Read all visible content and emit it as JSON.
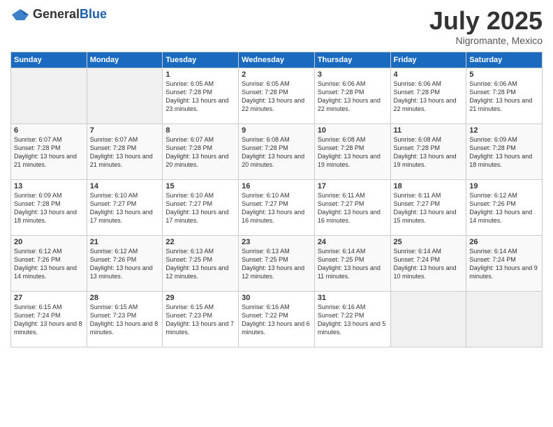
{
  "header": {
    "logo_general": "General",
    "logo_blue": "Blue",
    "month": "July 2025",
    "location": "Nigromante, Mexico"
  },
  "weekdays": [
    "Sunday",
    "Monday",
    "Tuesday",
    "Wednesday",
    "Thursday",
    "Friday",
    "Saturday"
  ],
  "weeks": [
    [
      {
        "day": "",
        "empty": true
      },
      {
        "day": "",
        "empty": true
      },
      {
        "day": "1",
        "sunrise": "Sunrise: 6:05 AM",
        "sunset": "Sunset: 7:28 PM",
        "daylight": "Daylight: 13 hours and 23 minutes."
      },
      {
        "day": "2",
        "sunrise": "Sunrise: 6:05 AM",
        "sunset": "Sunset: 7:28 PM",
        "daylight": "Daylight: 13 hours and 22 minutes."
      },
      {
        "day": "3",
        "sunrise": "Sunrise: 6:06 AM",
        "sunset": "Sunset: 7:28 PM",
        "daylight": "Daylight: 13 hours and 22 minutes."
      },
      {
        "day": "4",
        "sunrise": "Sunrise: 6:06 AM",
        "sunset": "Sunset: 7:28 PM",
        "daylight": "Daylight: 13 hours and 22 minutes."
      },
      {
        "day": "5",
        "sunrise": "Sunrise: 6:06 AM",
        "sunset": "Sunset: 7:28 PM",
        "daylight": "Daylight: 13 hours and 21 minutes."
      }
    ],
    [
      {
        "day": "6",
        "sunrise": "Sunrise: 6:07 AM",
        "sunset": "Sunset: 7:28 PM",
        "daylight": "Daylight: 13 hours and 21 minutes."
      },
      {
        "day": "7",
        "sunrise": "Sunrise: 6:07 AM",
        "sunset": "Sunset: 7:28 PM",
        "daylight": "Daylight: 13 hours and 21 minutes."
      },
      {
        "day": "8",
        "sunrise": "Sunrise: 6:07 AM",
        "sunset": "Sunset: 7:28 PM",
        "daylight": "Daylight: 13 hours and 20 minutes."
      },
      {
        "day": "9",
        "sunrise": "Sunrise: 6:08 AM",
        "sunset": "Sunset: 7:28 PM",
        "daylight": "Daylight: 13 hours and 20 minutes."
      },
      {
        "day": "10",
        "sunrise": "Sunrise: 6:08 AM",
        "sunset": "Sunset: 7:28 PM",
        "daylight": "Daylight: 13 hours and 19 minutes."
      },
      {
        "day": "11",
        "sunrise": "Sunrise: 6:08 AM",
        "sunset": "Sunset: 7:28 PM",
        "daylight": "Daylight: 13 hours and 19 minutes."
      },
      {
        "day": "12",
        "sunrise": "Sunrise: 6:09 AM",
        "sunset": "Sunset: 7:28 PM",
        "daylight": "Daylight: 13 hours and 18 minutes."
      }
    ],
    [
      {
        "day": "13",
        "sunrise": "Sunrise: 6:09 AM",
        "sunset": "Sunset: 7:28 PM",
        "daylight": "Daylight: 13 hours and 18 minutes."
      },
      {
        "day": "14",
        "sunrise": "Sunrise: 6:10 AM",
        "sunset": "Sunset: 7:27 PM",
        "daylight": "Daylight: 13 hours and 17 minutes."
      },
      {
        "day": "15",
        "sunrise": "Sunrise: 6:10 AM",
        "sunset": "Sunset: 7:27 PM",
        "daylight": "Daylight: 13 hours and 17 minutes."
      },
      {
        "day": "16",
        "sunrise": "Sunrise: 6:10 AM",
        "sunset": "Sunset: 7:27 PM",
        "daylight": "Daylight: 13 hours and 16 minutes."
      },
      {
        "day": "17",
        "sunrise": "Sunrise: 6:11 AM",
        "sunset": "Sunset: 7:27 PM",
        "daylight": "Daylight: 13 hours and 16 minutes."
      },
      {
        "day": "18",
        "sunrise": "Sunrise: 6:11 AM",
        "sunset": "Sunset: 7:27 PM",
        "daylight": "Daylight: 13 hours and 15 minutes."
      },
      {
        "day": "19",
        "sunrise": "Sunrise: 6:12 AM",
        "sunset": "Sunset: 7:26 PM",
        "daylight": "Daylight: 13 hours and 14 minutes."
      }
    ],
    [
      {
        "day": "20",
        "sunrise": "Sunrise: 6:12 AM",
        "sunset": "Sunset: 7:26 PM",
        "daylight": "Daylight: 13 hours and 14 minutes."
      },
      {
        "day": "21",
        "sunrise": "Sunrise: 6:12 AM",
        "sunset": "Sunset: 7:26 PM",
        "daylight": "Daylight: 13 hours and 13 minutes."
      },
      {
        "day": "22",
        "sunrise": "Sunrise: 6:13 AM",
        "sunset": "Sunset: 7:25 PM",
        "daylight": "Daylight: 13 hours and 12 minutes."
      },
      {
        "day": "23",
        "sunrise": "Sunrise: 6:13 AM",
        "sunset": "Sunset: 7:25 PM",
        "daylight": "Daylight: 13 hours and 12 minutes."
      },
      {
        "day": "24",
        "sunrise": "Sunrise: 6:14 AM",
        "sunset": "Sunset: 7:25 PM",
        "daylight": "Daylight: 13 hours and 11 minutes."
      },
      {
        "day": "25",
        "sunrise": "Sunrise: 6:14 AM",
        "sunset": "Sunset: 7:24 PM",
        "daylight": "Daylight: 13 hours and 10 minutes."
      },
      {
        "day": "26",
        "sunrise": "Sunrise: 6:14 AM",
        "sunset": "Sunset: 7:24 PM",
        "daylight": "Daylight: 13 hours and 9 minutes."
      }
    ],
    [
      {
        "day": "27",
        "sunrise": "Sunrise: 6:15 AM",
        "sunset": "Sunset: 7:24 PM",
        "daylight": "Daylight: 13 hours and 8 minutes."
      },
      {
        "day": "28",
        "sunrise": "Sunrise: 6:15 AM",
        "sunset": "Sunset: 7:23 PM",
        "daylight": "Daylight: 13 hours and 8 minutes."
      },
      {
        "day": "29",
        "sunrise": "Sunrise: 6:15 AM",
        "sunset": "Sunset: 7:23 PM",
        "daylight": "Daylight: 13 hours and 7 minutes."
      },
      {
        "day": "30",
        "sunrise": "Sunrise: 6:16 AM",
        "sunset": "Sunset: 7:22 PM",
        "daylight": "Daylight: 13 hours and 6 minutes."
      },
      {
        "day": "31",
        "sunrise": "Sunrise: 6:16 AM",
        "sunset": "Sunset: 7:22 PM",
        "daylight": "Daylight: 13 hours and 5 minutes."
      },
      {
        "day": "",
        "empty": true
      },
      {
        "day": "",
        "empty": true
      }
    ]
  ]
}
